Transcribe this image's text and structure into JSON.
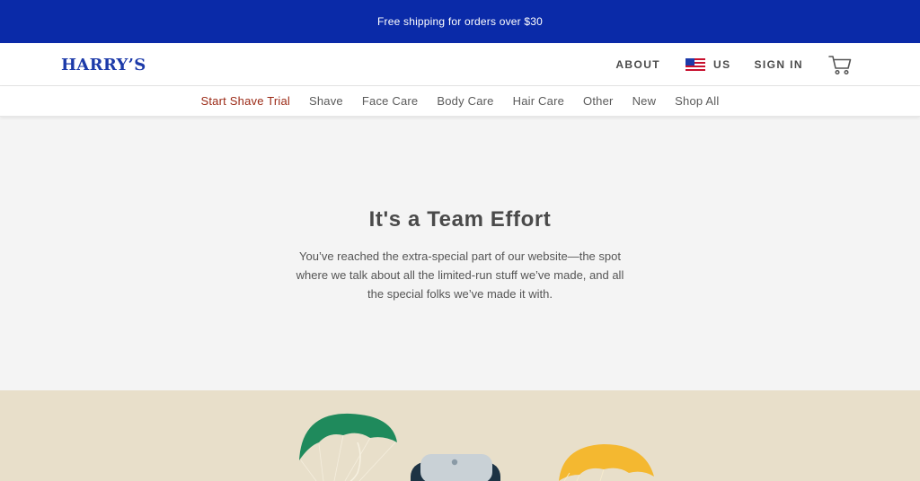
{
  "promo": {
    "text": "Free shipping for orders over $30"
  },
  "header": {
    "logo": "HARRY’S",
    "about_label": "ABOUT",
    "region_label": "US",
    "signin_label": "SIGN IN",
    "flag_icon": "us-flag-icon",
    "cart_icon": "cart-icon"
  },
  "nav": {
    "items": [
      {
        "label": "Start Shave Trial"
      },
      {
        "label": "Shave"
      },
      {
        "label": "Face Care"
      },
      {
        "label": "Body Care"
      },
      {
        "label": "Hair Care"
      },
      {
        "label": "Other"
      },
      {
        "label": "New"
      },
      {
        "label": "Shop All"
      }
    ]
  },
  "hero": {
    "title": "It's a Team Effort",
    "body": "You’ve reached the extra-special part of our website—the spot where we talk about all the limited-run stuff we’ve made, and all the special folks we’ve made it with."
  },
  "colors": {
    "promo_bg": "#0a2aa8",
    "brand_blue": "#1c3aa9",
    "nav_highlight": "#9b2a16",
    "hero_bg": "#f4f4f4",
    "feature_bg": "#e8dfca",
    "parachute_green": "#1f8a5c",
    "parachute_yellow": "#f4b830",
    "product_navy": "#1d3344"
  }
}
